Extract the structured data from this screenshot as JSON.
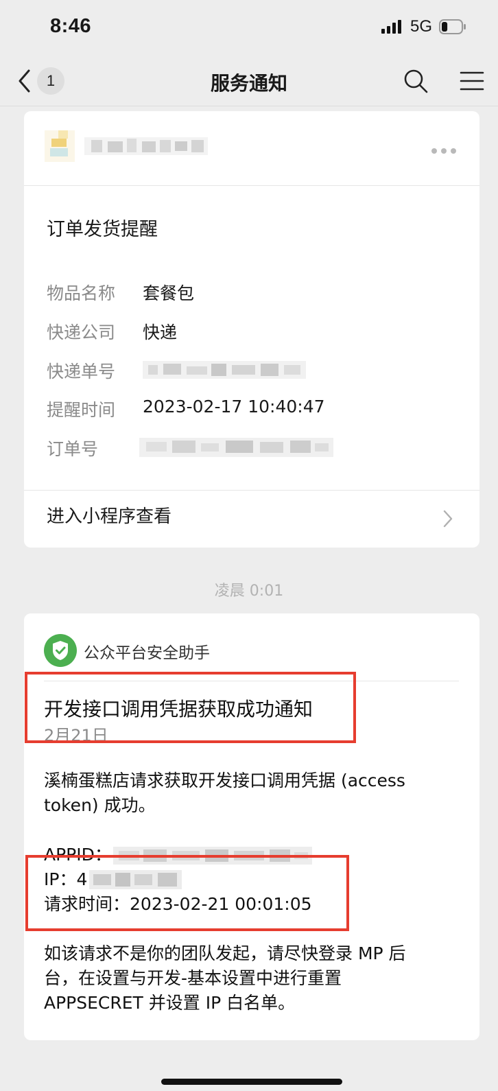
{
  "status_bar": {
    "time": "8:46",
    "network": "5G",
    "battery_level": 0.3
  },
  "nav": {
    "back_count": "1",
    "title": "服务通知",
    "icons": [
      "chevron-left-icon",
      "search-icon",
      "menu-icon"
    ]
  },
  "card1": {
    "title": "订单发货提醒",
    "fields": [
      {
        "label": "物品名称",
        "value": "套餐包"
      },
      {
        "label": "快递公司",
        "value": "快递"
      },
      {
        "label": "快递单号",
        "value": ""
      },
      {
        "label": "提醒时间",
        "value": "2023-02-17 10:40:47"
      },
      {
        "label": "订单号",
        "value": ""
      }
    ],
    "link_label": "进入小程序查看"
  },
  "time_separator": "凌晨 0:01",
  "card2": {
    "sender": "公众平台安全助手",
    "title": "开发接口调用凭据获取成功通知",
    "date": "2月21日",
    "body_line1": "溪楠蛋糕店请求获取开发接口调用凭据 (access",
    "body_line2": "token) 成功。",
    "appid_label": "APPID：",
    "ip_label": "IP：",
    "ip_prefix": "4",
    "request_time_label": "请求时间：",
    "request_time_value": "2023-02-21 00:01:05",
    "warning_line1": "如该请求不是你的团队发起，请尽快登录 MP 后",
    "warning_line2": "台，在设置与开发-基本设置中进行重置",
    "warning_line3": "APPSECRET 并设置 IP 白名单。"
  },
  "colors": {
    "background": "#ededed",
    "card": "#ffffff",
    "highlight_border": "#e63d2f",
    "shield_green": "#4caf50",
    "muted_text": "#8a8a8a"
  }
}
